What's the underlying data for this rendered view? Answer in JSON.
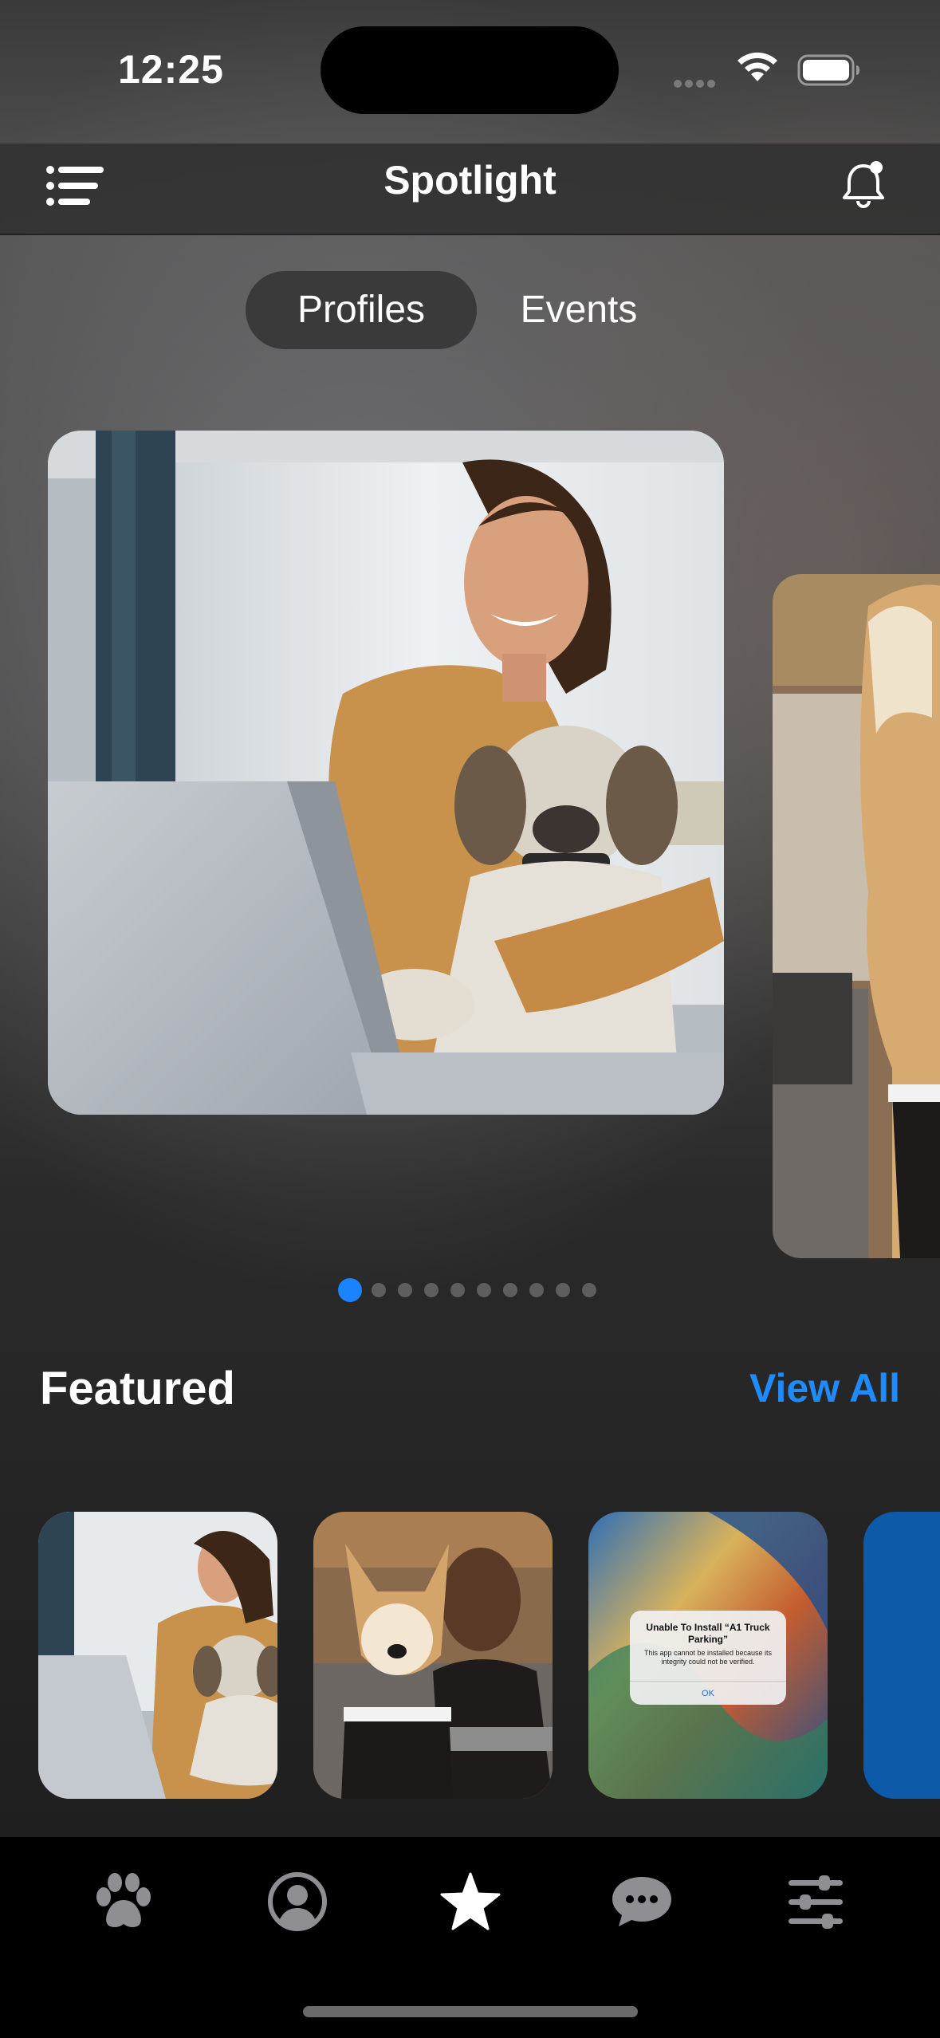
{
  "status_bar": {
    "time": "12:25"
  },
  "navbar": {
    "title": "Spotlight"
  },
  "segmented": {
    "tabs": [
      {
        "label": "Profiles",
        "selected": true
      },
      {
        "label": "Events",
        "selected": false
      }
    ]
  },
  "carousel": {
    "page_count": 10,
    "current_page": 1
  },
  "featured": {
    "title": "Featured",
    "view_all_label": "View All",
    "alert": {
      "title": "Unable To Install “A1 Truck Parking”",
      "message": "This app cannot be installed because its integrity could not be verified.",
      "ok_label": "OK"
    }
  },
  "tab_bar": {
    "items": [
      {
        "icon": "paw-icon",
        "selected": false
      },
      {
        "icon": "profile-icon",
        "selected": false
      },
      {
        "icon": "star-icon",
        "selected": true
      },
      {
        "icon": "chat-bubble-icon",
        "selected": false
      },
      {
        "icon": "sliders-icon",
        "selected": false
      }
    ]
  },
  "colors": {
    "accent": "#1a84ff",
    "tab_inactive": "#8e8e93",
    "tab_active": "#ffffff"
  }
}
